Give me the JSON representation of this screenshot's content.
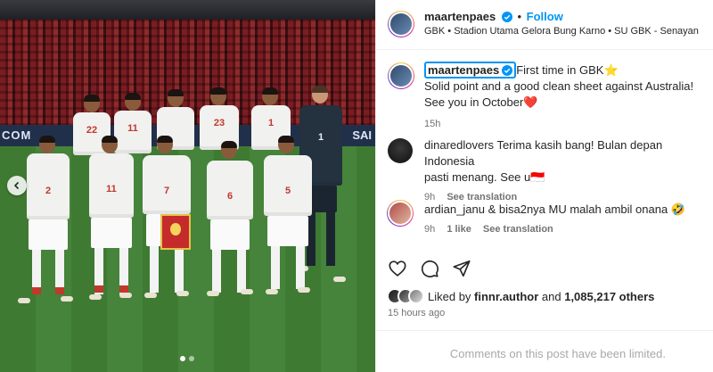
{
  "post": {
    "author": "maartenpaes",
    "follow_label": "Follow",
    "separator": "•",
    "location": "GBK • Stadion Utama Gelora Bung Karno • SU GBK - Senayan",
    "caption_author": "maartenpaes",
    "caption_line1": "First time in GBK⭐",
    "caption_line2": "Solid point and a good clean sheet against Australia!",
    "caption_line3": "See you in October❤️",
    "caption_time": "15h"
  },
  "photo": {
    "board_left": "COM",
    "board_right": "SAI",
    "carousel_dots": 2,
    "active_dot": 0
  },
  "comments": [
    {
      "user": "dinaredlovers",
      "text_line1": "Terima kasih bang! Bulan depan Indonesia",
      "text_line2": "pasti menang. See u🇮🇩",
      "time": "9h",
      "likes": "",
      "translate": "See translation"
    },
    {
      "user": "ardian_janu",
      "text_line1": "& bisa2nya MU malah ambil onana 🤣",
      "text_line2": "",
      "time": "9h",
      "likes": "1 like",
      "translate": "See translation"
    }
  ],
  "engagement": {
    "liked_prefix": "Liked by",
    "liked_user": "finnr.author",
    "and": "and",
    "others": "1,085,217 others",
    "posted_ago": "15 hours ago"
  },
  "footer": {
    "limited_text": "Comments on this post have been limited."
  },
  "icons": [
    "chevron-left-icon",
    "verified-badge-icon",
    "heart-icon",
    "comment-icon",
    "share-icon"
  ],
  "colors": {
    "accent": "#0095f6",
    "muted": "#737373",
    "text": "#262626"
  }
}
